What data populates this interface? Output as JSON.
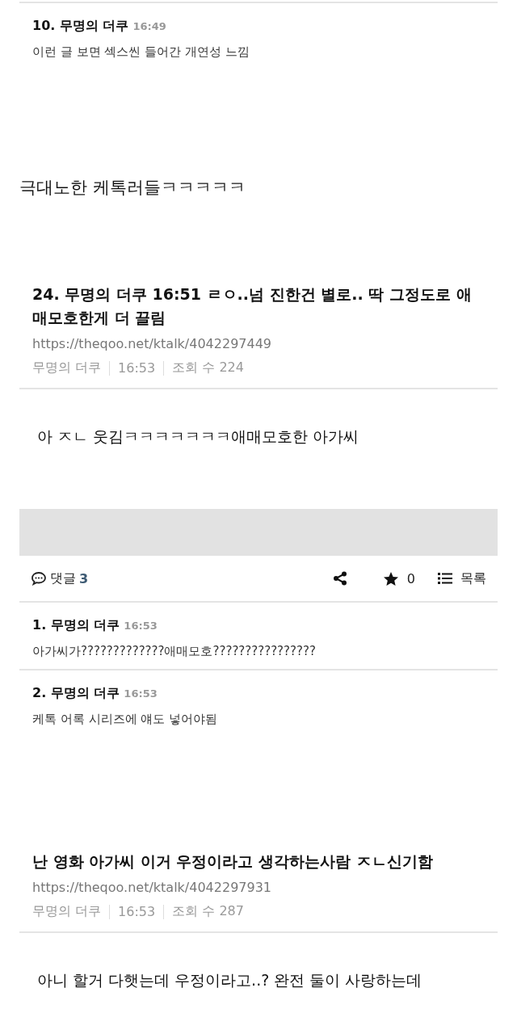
{
  "sections": [
    {
      "kind": "comments",
      "items": [
        {
          "author": "10. 무명의 더쿠",
          "time": "16:49",
          "text": "이런 글 보면 섹스씬 들어간 개연성 느낌"
        }
      ]
    },
    {
      "kind": "caption",
      "text": "극대노한 케톡러들ㅋㅋㅋㅋㅋ"
    },
    {
      "kind": "post",
      "title": "24. 무명의 더쿠 16:51 ㄹㅇ..넘 진한건 별로.. 딱 그정도로 애매모호한게 더 끌림",
      "url": "https://theqoo.net/ktalk/4042297449",
      "author": "무명의 더쿠",
      "time": "16:53",
      "views": "조회 수 224"
    },
    {
      "kind": "caption",
      "text": "아 ㅈㄴ 웃김ㅋㅋㅋㅋㅋㅋㅋ애매모호한 아가씨"
    },
    {
      "kind": "banner"
    },
    {
      "kind": "comment_bar",
      "label": "댓글",
      "count": "3",
      "star_count": "0",
      "list_label": "목록"
    },
    {
      "kind": "comments",
      "items": [
        {
          "author": "1. 무명의 더쿠",
          "time": "16:53",
          "text": "아가씨가?????????????애매모호????????????????"
        },
        {
          "author": "2. 무명의 더쿠",
          "time": "16:53",
          "text": "케톡 어록 시리즈에 얘도 넣어야됨"
        }
      ]
    },
    {
      "kind": "post",
      "title": "난 영화 아가씨 이거 우정이라고 생각하는사람 ㅈㄴ신기함",
      "url": "https://theqoo.net/ktalk/4042297931",
      "author": "무명의 더쿠",
      "time": "16:53",
      "views": "조회 수 287"
    },
    {
      "kind": "caption",
      "text": "아니 할거 다햇는데 우정이라고..? 완전 둘이 사랑하는데"
    }
  ]
}
